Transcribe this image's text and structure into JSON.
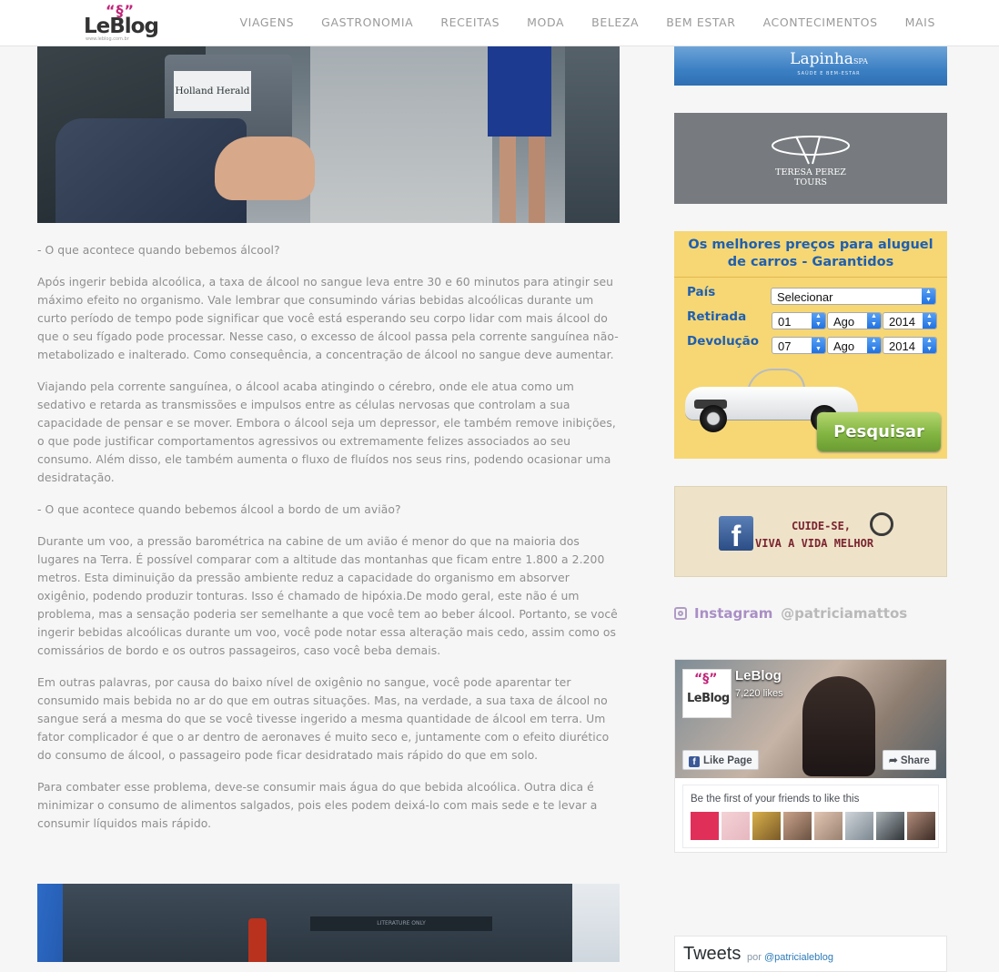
{
  "header": {
    "logo_mark": "“§”",
    "logo_text": "LeBlog",
    "logo_sub": "www.leblog.com.br",
    "nav": [
      "VIAGENS",
      "GASTRONOMIA",
      "RECEITAS",
      "MODA",
      "BELEZA",
      "BEM ESTAR",
      "ACONTECIMENTOS",
      "MAIS"
    ]
  },
  "hero": {
    "magazine_text": "Holland Herald"
  },
  "article": {
    "paragraphs": [
      "- O que acontece quando bebemos álcool?",
      "Após ingerir bebida alcoólica, a taxa de álcool no sangue leva entre 30 e 60 minutos para atingir seu máximo efeito no organismo. Vale lembrar que consumindo várias bebidas alcoólicas durante um curto período de tempo pode significar que você está esperando seu corpo lidar com mais álcool do que o seu fígado pode processar. Nesse caso, o excesso de álcool passa pela corrente sanguínea não-metabolizado e inalterado. Como consequência, a concentração de álcool no sangue deve aumentar.",
      "Viajando pela corrente sanguínea, o álcool acaba atingindo o cérebro, onde ele atua como um sedativo e retarda as transmissões e impulsos entre as células nervosas que controlam a sua capacidade de pensar e se mover. Embora o álcool seja um depressor, ele também remove inibições, o que pode justificar comportamentos agressivos ou extremamente felizes associados ao seu consumo. Além disso, ele também aumenta o fluxo de fluídos nos seus rins, podendo ocasionar uma desidratação.",
      "- O que acontece quando bebemos álcool a bordo de um avião?",
      "Durante um voo, a pressão barométrica na cabine de um avião é menor do que na maioria dos lugares na Terra. É possível comparar com a altitude das montanhas que ficam entre 1.800 a 2.200 metros. Esta diminuição da pressão ambiente reduz a capacidade do organismo em absorver oxigênio, podendo produzir tonturas. Isso é chamado de hipóxia.De modo geral, este não é um problema, mas a sensação poderia ser semelhante a que você tem ao beber álcool. Portanto, se você ingerir bebidas alcoólicas durante um voo, você pode notar essa alteração mais cedo, assim como os comissários de bordo e os outros passageiros, caso você beba demais.",
      "Em outras palavras, por causa do baixo nível de oxigênio no sangue, você pode aparentar ter consumido mais bebida no ar do que em outras situações. Mas, na verdade, a sua taxa de álcool no sangue será a mesma do que se você tivesse ingerido a mesma quantidade de álcool em terra. Um fator complicador é que o ar dentro de aeronaves é muito seco e, juntamente com o efeito diurético do consumo de álcool, o passageiro pode ficar desidratado mais rápido do que em solo.",
      "Para combater esse problema, deve-se consumir mais água do que bebida alcoólica. Outra dica é minimizar o consumo de alimentos salgados, pois eles podem deixá-lo com mais sede e te levar a consumir líquidos mais rápido."
    ],
    "bottom_photo_text": "LITERATURE ONLY"
  },
  "sidebar": {
    "lapinha": {
      "brand": "Lapinha",
      "brand_small": "SPA",
      "tagline": "SAÚDE E BEM-ESTAR"
    },
    "teresa": {
      "name_line1": "TERESA PEREZ",
      "name_line2": "TOURS"
    },
    "cars": {
      "headline": "Os melhores preços para aluguel de carros - Garantidos",
      "pais_label": "País",
      "pais_value": "Selecionar",
      "retirada_label": "Retirada",
      "retirada": {
        "day": "01",
        "month": "Ago",
        "year": "2014"
      },
      "devolucao_label": "Devolução",
      "devolucao": {
        "day": "07",
        "month": "Ago",
        "year": "2014"
      },
      "search_label": "Pesquisar"
    },
    "cuide": {
      "fb_letter": "f",
      "line1": "CUIDE-SE,",
      "line2": "VIVA A VIDA MELHOR"
    },
    "instagram": {
      "name": "Instagram",
      "handle": "@patriciamattos"
    },
    "facebook": {
      "page_name": "LeBlog",
      "likes": "7,220 likes",
      "like_button": "Like Page",
      "share_button": "Share",
      "friends_text": "Be the first of your friends to like this",
      "pic_mark": "“§”",
      "pic_text": "LeBlog"
    },
    "tweets": {
      "title": "Tweets",
      "by": "por",
      "handle": "@patricialeblog"
    }
  },
  "colors": {
    "accent": "#c2257a",
    "nav": "#9a9a9a",
    "car_blue": "#1f5fb0",
    "search_green": "#82b542",
    "instagram": "#a98fc5"
  }
}
